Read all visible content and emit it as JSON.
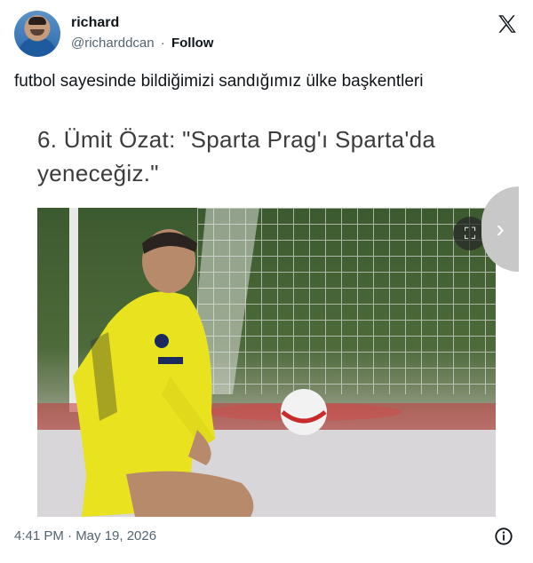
{
  "author": {
    "display_name": "richard",
    "handle": "@richarddcan",
    "separator": "·",
    "follow_label": "Follow"
  },
  "tweet": {
    "text": "futbol sayesinde bildiğimizi sandığımız ülke başkentleri"
  },
  "media": {
    "card_title": "6. Ümit Özat: \"Sparta Prag'ı Sparta'da yeneceğiz.\"",
    "photo_description_icon": "football-photo",
    "expand_icon": "expand-icon",
    "next_icon": "chevron-right-icon"
  },
  "footer": {
    "timestamp": "4:41 PM · May 19, 2026"
  },
  "colors": {
    "text_primary": "#0f1419",
    "text_secondary": "#536471",
    "jersey_yellow": "#e9e21e"
  }
}
